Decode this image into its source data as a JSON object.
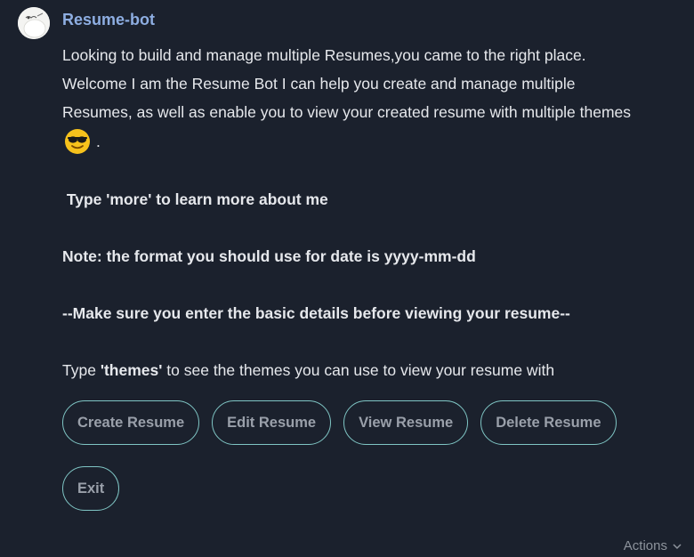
{
  "message": {
    "sender": "Resume-bot",
    "lines": [
      "Looking to build and manage multiple Resumes,you came to the right place.",
      "Welcome I am the Resume Bot I can help you create and manage multiple",
      "Resumes, as well as enable you to view your created resume with multiple themes"
    ],
    "emoji_suffix": ".",
    "more_hint": " Type 'more' to learn more about me",
    "date_note": "Note: the format you should use for date is yyyy-mm-dd",
    "basic_details": "--Make sure you enter the basic details before viewing your resume--",
    "themes_prefix": "Type ",
    "themes_keyword": "'themes'",
    "themes_suffix": " to see the themes you can use to view your resume with"
  },
  "quick_replies": [
    "Create Resume",
    "Edit Resume",
    "View Resume",
    "Delete Resume",
    "Exit"
  ],
  "footer": {
    "actions_label": "Actions"
  },
  "colors": {
    "background": "#1b212d",
    "sender": "#8eaee2",
    "button_border": "#7fc5c4",
    "button_text": "#9aa0aa"
  },
  "icons": {
    "avatar": "bot-avatar",
    "emoji": "sunglasses-emoji-icon",
    "actions": "chevron-down-icon"
  }
}
